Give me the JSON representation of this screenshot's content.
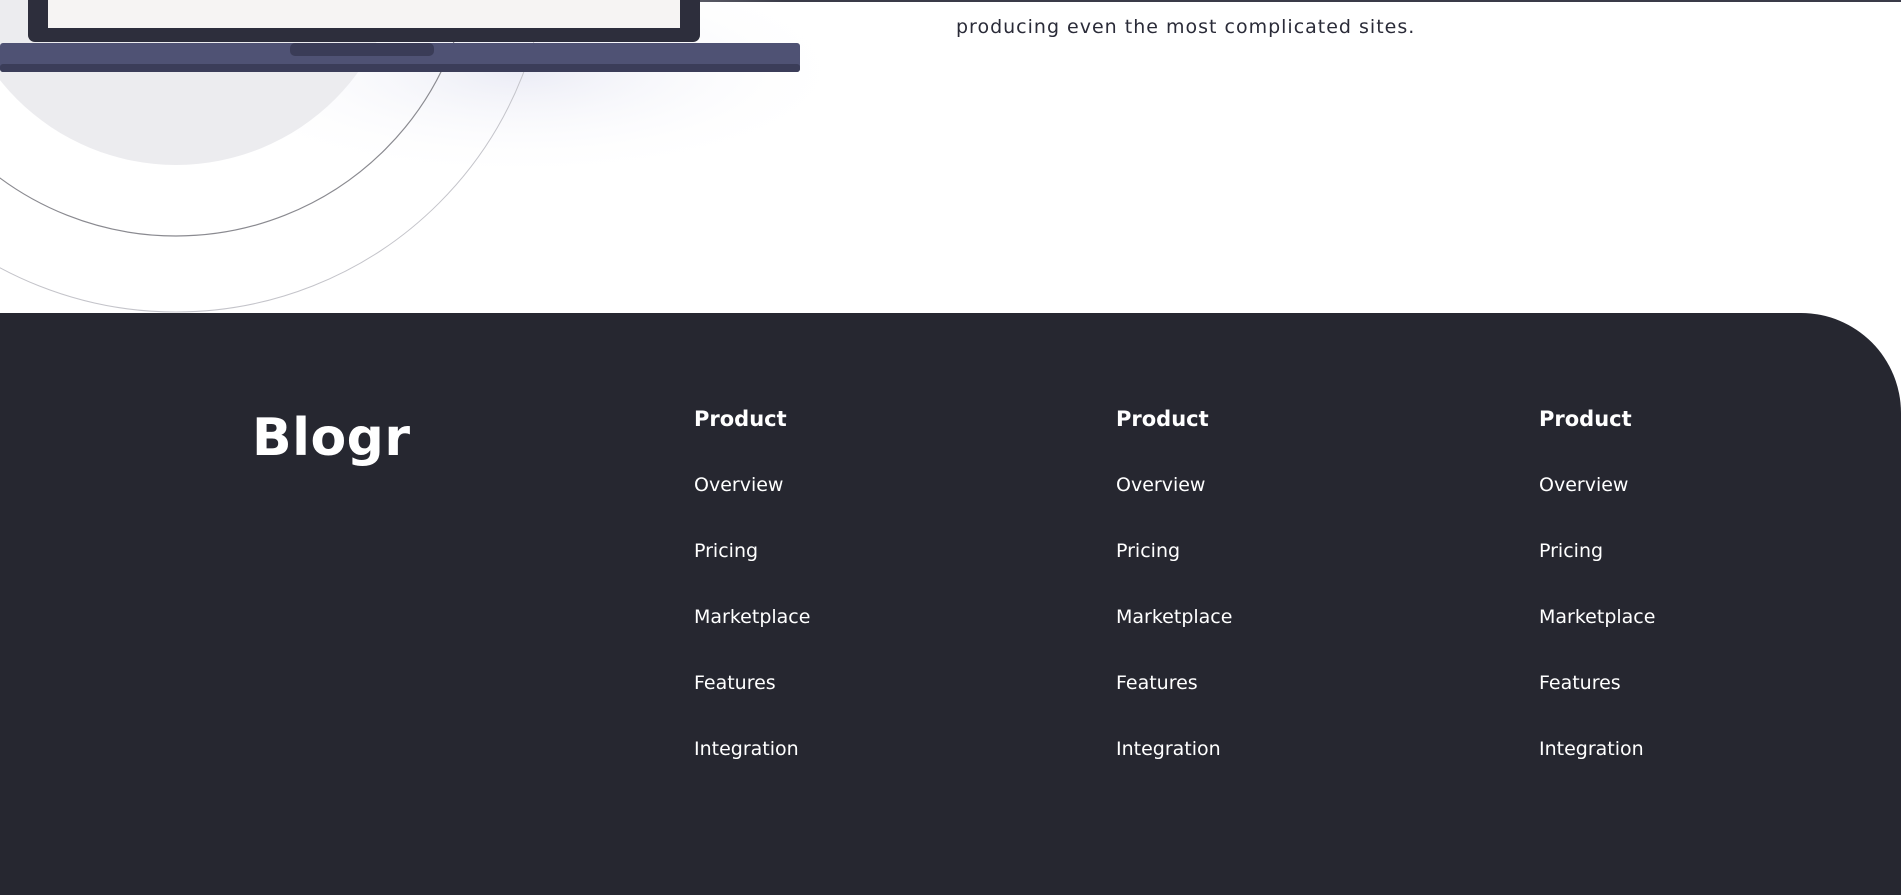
{
  "hero": {
    "description_fragment": "producing even the most complicated sites."
  },
  "footer": {
    "brand": "Blogr",
    "columns": [
      {
        "heading": "Product",
        "links": [
          "Overview",
          "Pricing",
          "Marketplace",
          "Features",
          "Integration"
        ]
      },
      {
        "heading": "Product",
        "links": [
          "Overview",
          "Pricing",
          "Marketplace",
          "Features",
          "Integration"
        ]
      },
      {
        "heading": "Product",
        "links": [
          "Overview",
          "Pricing",
          "Marketplace",
          "Features",
          "Integration"
        ]
      }
    ]
  },
  "colors": {
    "footer_bg": "#262730",
    "laptop_base": "#4f5274",
    "text_dark": "#2a2b38",
    "text_light": "#ffffff"
  }
}
